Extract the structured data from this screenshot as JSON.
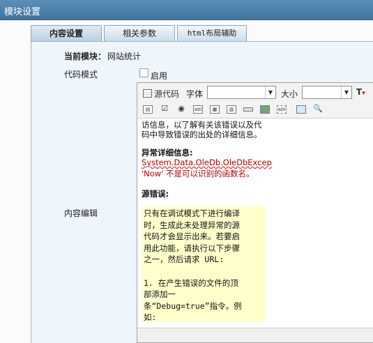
{
  "window": {
    "title": "模块设置"
  },
  "tabs": [
    {
      "label": "内容设置",
      "active": true
    },
    {
      "label": "相关参数",
      "active": false
    },
    {
      "label": "html布局辅助",
      "active": false
    }
  ],
  "form": {
    "current_module_label": "当前模块：",
    "current_module_value": "网站统计",
    "code_mode_label": "代码模式",
    "enable_label": "启用",
    "content_edit_label": "内容编辑"
  },
  "editor": {
    "source_label": "源代码",
    "font_label": "字体",
    "size_label": "大小",
    "font_value": "",
    "size_value": "",
    "toolbar_icons": [
      "form-icon",
      "checkbox-icon",
      "radio-icon",
      "textfield-icon",
      "textarea-icon",
      "select-icon",
      "button-icon",
      "image-button-icon",
      "hidden-field-icon",
      "flash-icon",
      "preview-icon"
    ],
    "content": {
      "line1": "访信息，以了解有关该错误以及代",
      "line2": "码中导致错误的出处的详细信息。",
      "exception_heading": "异常详细信息:",
      "exception_line1": "System.Data.OleDb.OleDbExcep",
      "exception_line2": "'Now' 不是可以识别的函数名。",
      "source_error_heading": "源错误:",
      "code_block": "只有在调试模式下进行编译\n时，生成此未处理异常的源\n代码才会显示出来。若要启\n用此功能，请执行以下步骤\n之一，然后请求 URL:\n\n1. 在产生错误的文件的顶\n部添加一\n条“Debug=true”指令。例\n如:"
    }
  }
}
